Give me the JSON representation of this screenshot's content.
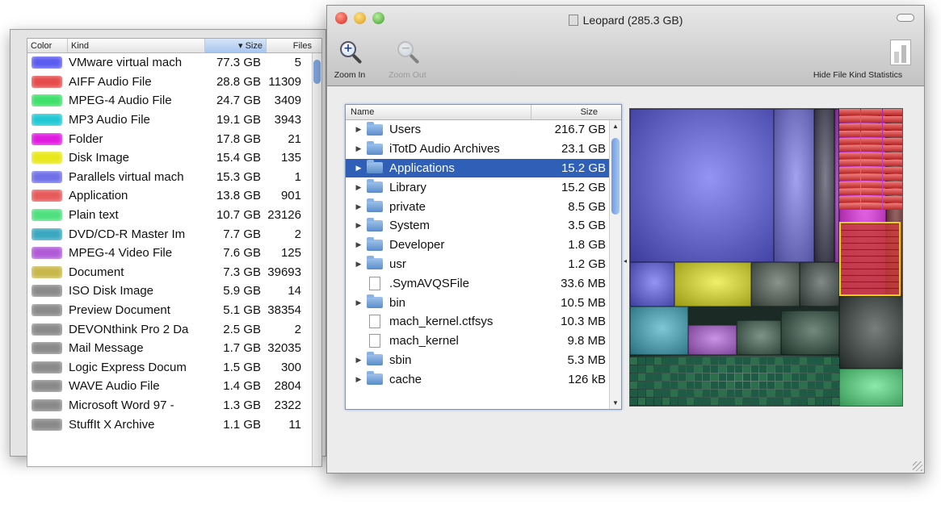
{
  "window": {
    "title": "Leopard (285.3 GB)"
  },
  "toolbar": {
    "zoom_in_label": "Zoom In",
    "zoom_out_label": "Zoom Out",
    "hide_stats_label": "Hide File Kind Statistics"
  },
  "kind_table": {
    "columns": [
      "Color",
      "Kind",
      "Size",
      "Files"
    ],
    "rows": [
      {
        "kind": "VMware virtual mach",
        "size": "77.3 GB",
        "files": "5",
        "color": "#5b5bf0"
      },
      {
        "kind": "AIFF Audio File",
        "size": "28.8 GB",
        "files": "11309",
        "color": "#e64a4a"
      },
      {
        "kind": "MPEG-4 Audio File",
        "size": "24.7 GB",
        "files": "3409",
        "color": "#3fe06a"
      },
      {
        "kind": "MP3 Audio File",
        "size": "19.1 GB",
        "files": "3943",
        "color": "#21c8d4"
      },
      {
        "kind": "Folder",
        "size": "17.8 GB",
        "files": "21",
        "color": "#e01ae0"
      },
      {
        "kind": "Disk Image",
        "size": "15.4 GB",
        "files": "135",
        "color": "#e8e81a"
      },
      {
        "kind": "Parallels virtual mach",
        "size": "15.3 GB",
        "files": "1",
        "color": "#7070e8"
      },
      {
        "kind": "Application",
        "size": "13.8 GB",
        "files": "901",
        "color": "#e85a5a"
      },
      {
        "kind": "Plain text",
        "size": "10.7 GB",
        "files": "23126",
        "color": "#4ee07e"
      },
      {
        "kind": "DVD/CD-R Master Im",
        "size": "7.7 GB",
        "files": "2",
        "color": "#3aa8c0"
      },
      {
        "kind": "MPEG-4 Video File",
        "size": "7.6 GB",
        "files": "125",
        "color": "#b05ad8"
      },
      {
        "kind": "Document",
        "size": "7.3 GB",
        "files": "39693",
        "color": "#c8b84a"
      },
      {
        "kind": "ISO Disk Image",
        "size": "5.9 GB",
        "files": "14",
        "color": "#8a8a8a"
      },
      {
        "kind": "Preview Document",
        "size": "5.1 GB",
        "files": "38354",
        "color": "#8a8a8a"
      },
      {
        "kind": "DEVONthink Pro 2 Da",
        "size": "2.5 GB",
        "files": "2",
        "color": "#8a8a8a"
      },
      {
        "kind": "Mail Message",
        "size": "1.7 GB",
        "files": "32035",
        "color": "#8a8a8a"
      },
      {
        "kind": "Logic Express Docum",
        "size": "1.5 GB",
        "files": "300",
        "color": "#8a8a8a"
      },
      {
        "kind": "WAVE Audio File",
        "size": "1.4 GB",
        "files": "2804",
        "color": "#8a8a8a"
      },
      {
        "kind": "Microsoft Word 97 -",
        "size": "1.3 GB",
        "files": "2322",
        "color": "#8a8a8a"
      },
      {
        "kind": "StuffIt X Archive",
        "size": "1.1 GB",
        "files": "11",
        "color": "#8a8a8a"
      }
    ]
  },
  "file_browser": {
    "columns": [
      "Name",
      "Size"
    ],
    "rows": [
      {
        "name": "Users",
        "size": "216.7 GB",
        "type": "folder",
        "selected": false
      },
      {
        "name": "iTotD Audio Archives",
        "size": "23.1 GB",
        "type": "folder",
        "selected": false
      },
      {
        "name": "Applications",
        "size": "15.2 GB",
        "type": "folder",
        "selected": true
      },
      {
        "name": "Library",
        "size": "15.2 GB",
        "type": "folder",
        "selected": false
      },
      {
        "name": "private",
        "size": "8.5 GB",
        "type": "folder",
        "selected": false
      },
      {
        "name": "System",
        "size": "3.5 GB",
        "type": "folder",
        "selected": false
      },
      {
        "name": "Developer",
        "size": "1.8 GB",
        "type": "folder",
        "selected": false
      },
      {
        "name": "usr",
        "size": "1.2 GB",
        "type": "folder",
        "selected": false
      },
      {
        "name": ".SymAVQSFile",
        "size": "33.6 MB",
        "type": "file",
        "selected": false
      },
      {
        "name": "bin",
        "size": "10.5 MB",
        "type": "folder",
        "selected": false
      },
      {
        "name": "mach_kernel.ctfsys",
        "size": "10.3 MB",
        "type": "file",
        "selected": false
      },
      {
        "name": "mach_kernel",
        "size": "9.8 MB",
        "type": "file",
        "selected": false
      },
      {
        "name": "sbin",
        "size": "5.3 MB",
        "type": "folder",
        "selected": false
      },
      {
        "name": "cache",
        "size": "126 kB",
        "type": "folder",
        "selected": false
      }
    ]
  },
  "colors": {
    "selection": "#2f5fb7",
    "treemap_highlight": "#f0d400"
  }
}
